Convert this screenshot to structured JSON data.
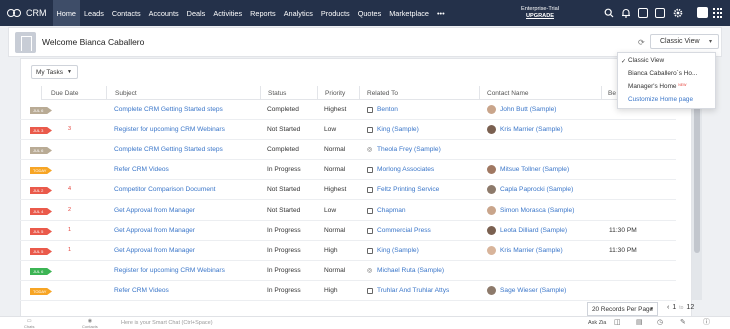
{
  "app": {
    "name": "CRM"
  },
  "nav": [
    "Home",
    "Leads",
    "Contacts",
    "Accounts",
    "Deals",
    "Activities",
    "Reports",
    "Analytics",
    "Products",
    "Quotes",
    "Marketplace",
    "•••"
  ],
  "trial": {
    "label": "Enterprise-Trial",
    "upgrade": "UPGRADE"
  },
  "top_icons": [
    "search-icon",
    "bell-icon",
    "calendar-icon",
    "mail-icon",
    "gear-icon",
    "user-avatar",
    "apps-grid-icon"
  ],
  "welcome": {
    "title": "Welcome Bianca Caballero",
    "view_button": "Classic View"
  },
  "view_menu": {
    "items": [
      "Classic View",
      "Bianca Caballero´s Ho...",
      "Manager's Home",
      "Customize Home page"
    ],
    "new_badge": "NEW",
    "selected_index": 0
  },
  "filter": {
    "label": "My Tasks"
  },
  "columns": [
    "Due Date",
    "Subject",
    "Status",
    "Priority",
    "Related To",
    "Contact Name",
    "Be"
  ],
  "rows": [
    {
      "due": "JUL 6",
      "due_color": "gray",
      "badge": "",
      "subject": "Complete CRM Getting Started steps",
      "status": "Completed",
      "priority": "Highest",
      "related": "Benton",
      "related_icon": "account-icon",
      "contact": "John Butt (Sample)",
      "time": ""
    },
    {
      "due": "JUL 3",
      "due_color": "red",
      "badge": "3",
      "subject": "Register for upcoming CRM Webinars",
      "status": "Not Started",
      "priority": "Low",
      "related": "King (Sample)",
      "related_icon": "account-icon",
      "contact": "Kris Marrier (Sample)",
      "time": ""
    },
    {
      "due": "JUL 6",
      "due_color": "gray",
      "badge": "",
      "subject": "Complete CRM Getting Started steps",
      "status": "Completed",
      "priority": "Normal",
      "related": "Theola Frey (Sample)",
      "related_icon": "lead-icon",
      "contact": "",
      "time": ""
    },
    {
      "due": "TODAY",
      "due_color": "orange",
      "badge": "",
      "subject": "Refer CRM Videos",
      "status": "In Progress",
      "priority": "Normal",
      "related": "Morlong Associates",
      "related_icon": "account-icon",
      "contact": "Mitsue Tollner (Sample)",
      "time": ""
    },
    {
      "due": "JUL 2",
      "due_color": "red",
      "badge": "4",
      "subject": "Competitor Comparison Document",
      "status": "Not Started",
      "priority": "Highest",
      "related": "Feltz Printing Service",
      "related_icon": "account-icon",
      "contact": "Capla Paprocki (Sample)",
      "time": ""
    },
    {
      "due": "JUL 4",
      "due_color": "red",
      "badge": "2",
      "subject": "Get Approval from Manager",
      "status": "Not Started",
      "priority": "Low",
      "related": "Chapman",
      "related_icon": "account-icon",
      "contact": "Simon Morasca (Sample)",
      "time": ""
    },
    {
      "due": "JUL 5",
      "due_color": "red",
      "badge": "1",
      "subject": "Get Approval from Manager",
      "status": "In Progress",
      "priority": "Normal",
      "related": "Commercial Press",
      "related_icon": "account-icon",
      "contact": "Leota Dilliard (Sample)",
      "time": "11:30 PM"
    },
    {
      "due": "JUL 5",
      "due_color": "red",
      "badge": "1",
      "subject": "Get Approval from Manager",
      "status": "In Progress",
      "priority": "High",
      "related": "King (Sample)",
      "related_icon": "account-icon",
      "contact": "Kris Marrier (Sample)",
      "time": "11:30 PM"
    },
    {
      "due": "JUL 6",
      "due_color": "green",
      "badge": "",
      "subject": "Register for upcoming CRM Webinars",
      "status": "In Progress",
      "priority": "Normal",
      "related": "Michael Ruta (Sample)",
      "related_icon": "lead-icon",
      "contact": "",
      "time": ""
    },
    {
      "due": "TODAY",
      "due_color": "orange",
      "badge": "",
      "subject": "Refer CRM Videos",
      "status": "In Progress",
      "priority": "High",
      "related": "Truhlar And Truhlar Attys",
      "related_icon": "account-icon",
      "contact": "Sage Wieser (Sample)",
      "time": ""
    }
  ],
  "pager": {
    "per_page": "20 Records Per Page",
    "range_start": "1",
    "range_sep": "to",
    "range_end": "12"
  },
  "bottom": {
    "chats": "Chats",
    "contacts": "Contacts",
    "smart_chat": "Here is your Smart Chat (Ctrl+Space)",
    "zia": "Ask Zia"
  },
  "colors": {
    "nav_bg": "#24314a",
    "link": "#3a76c9",
    "overdue": "#ea5a4b",
    "today": "#f7a525",
    "completed": "#b9ab95",
    "upcoming": "#3cb454"
  }
}
